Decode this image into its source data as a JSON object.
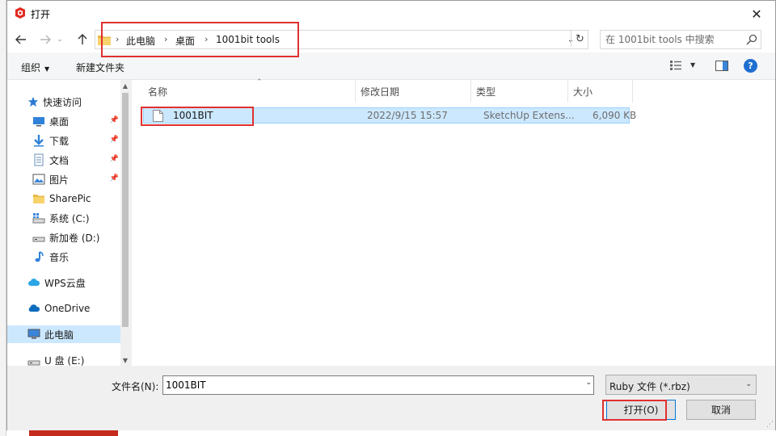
{
  "window": {
    "title": "打开",
    "close_glyph": "✕"
  },
  "address": {
    "breadcrumbs": [
      "此电脑",
      "桌面",
      "1001bit tools"
    ],
    "separator": "›",
    "search_placeholder": "在 1001bit tools 中搜索"
  },
  "toolbar": {
    "organize": "组织",
    "new_folder": "新建文件夹"
  },
  "nav": {
    "quick_access": "快速访问",
    "items": [
      {
        "label": "桌面",
        "pinned": true
      },
      {
        "label": "下载",
        "pinned": true
      },
      {
        "label": "文档",
        "pinned": true
      },
      {
        "label": "图片",
        "pinned": true
      },
      {
        "label": "SharePic",
        "pinned": false
      },
      {
        "label": "系统 (C:)",
        "pinned": false
      },
      {
        "label": "新加卷 (D:)",
        "pinned": false
      },
      {
        "label": "音乐",
        "pinned": false
      },
      {
        "label": "WPS云盘",
        "pinned": false
      },
      {
        "label": "OneDrive",
        "pinned": false
      },
      {
        "label": "此电脑",
        "pinned": false
      },
      {
        "label": "U 盘 (E:)",
        "pinned": false
      }
    ],
    "pin_glyph": "📌"
  },
  "columns": {
    "name": "名称",
    "modified": "修改日期",
    "type": "类型",
    "size": "大小"
  },
  "files": [
    {
      "name": "1001BIT",
      "modified": "2022/9/15 15:57",
      "type": "SketchUp Extens...",
      "size": "6,090 KB"
    }
  ],
  "bottom": {
    "filename_label": "文件名(N):",
    "filename_value": "1001BIT",
    "filetype": "Ruby 文件 (*.rbz)",
    "open": "打开(O)",
    "cancel": "取消"
  },
  "colors": {
    "accent": "#0078d7",
    "selection": "#cce8ff",
    "annotation": "#e03030",
    "help": "#1f6fd0"
  }
}
